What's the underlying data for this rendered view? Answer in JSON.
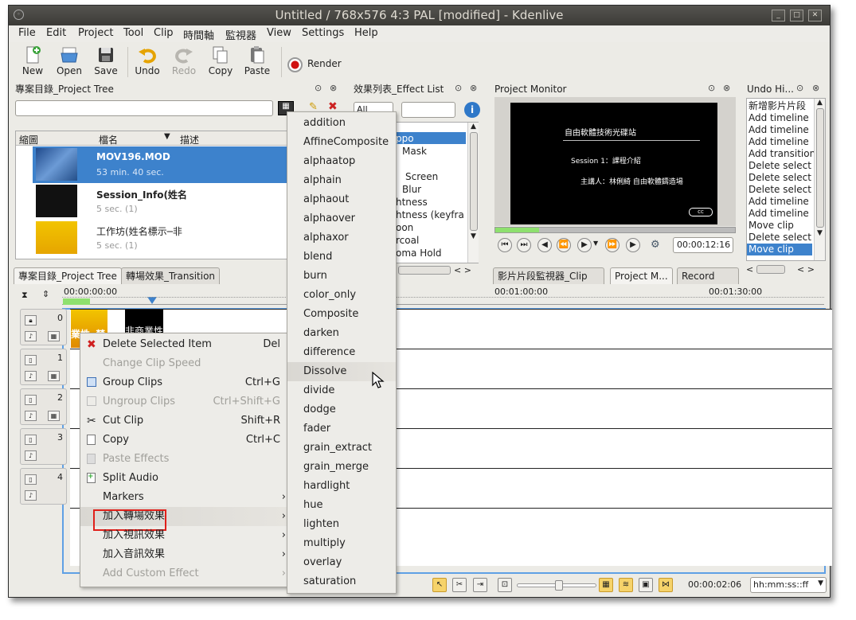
{
  "window": {
    "title": "Untitled / 768x576 4:3 PAL [modified]  -  Kdenlive"
  },
  "menubar": [
    "File",
    "Edit",
    "Project",
    "Tool",
    "Clip",
    "時間軸",
    "監視器",
    "View",
    "Settings",
    "Help"
  ],
  "toolbar": {
    "new": "New",
    "open": "Open",
    "save": "Save",
    "undo": "Undo",
    "redo": "Redo",
    "copy": "Copy",
    "paste": "Paste",
    "render": "Render"
  },
  "project_tree": {
    "title": "專案目錄_Project Tree",
    "columns": [
      "縮圖",
      "檔名",
      "描述"
    ],
    "items": [
      {
        "name": "MOV196.MOD",
        "info": "53 min. 40 sec."
      },
      {
        "name": "Session_Info(姓名",
        "info": "5 sec. (1)"
      },
      {
        "name": "工作坊(姓名標示─非",
        "info": "5 sec. (1)"
      }
    ],
    "tabs": [
      "專案目錄_Project Tree",
      "轉場效果_Transition"
    ]
  },
  "effect_list": {
    "title": "效果列表_Effect List",
    "filter": "All",
    "items": [
      "ppo",
      "Mask",
      "",
      "Screen",
      "Blur",
      "htness",
      "htness (keyfra",
      "oon",
      "rcoal",
      "oma Hold"
    ]
  },
  "monitor": {
    "title": "Project Monitor",
    "screen_line1": "自由軟體技術光碟站",
    "screen_line2": "Session 1：課程介紹",
    "screen_line3": "主講人：林俐綺 自由軟體鑄造場",
    "timecode": "00:00:12:16",
    "tabs": [
      "影片片段監視器_Clip M...",
      "Project M...",
      "Record M..."
    ]
  },
  "undo": {
    "title": "Undo Hi...",
    "items": [
      "新增影片片段",
      "Add timeline",
      "Add timeline",
      "Add timeline",
      "Add transition",
      "Delete select",
      "Delete select",
      "Delete select",
      "Add timeline",
      "Add timeline",
      "Move clip",
      "Delete select",
      "Move clip"
    ]
  },
  "timeline": {
    "ruler": [
      "00:00:00:00",
      "00:01:00:00",
      "00:01:30:00"
    ],
    "tracks": [
      "0",
      "1",
      "2",
      "3",
      "4"
    ],
    "clip_text1": "業性─禁",
    "clip_text2": "非商業性─",
    "timecode": "00:00:02:06",
    "format": "hh:mm:ss::ff"
  },
  "context_menu": {
    "items": [
      {
        "label": "Delete Selected Item",
        "shortcut": "Del",
        "enabled": true
      },
      {
        "label": "Change Clip Speed",
        "shortcut": "",
        "enabled": false
      },
      {
        "label": "Group Clips",
        "shortcut": "Ctrl+G",
        "enabled": true
      },
      {
        "label": "Ungroup Clips",
        "shortcut": "Ctrl+Shift+G",
        "enabled": false
      },
      {
        "label": "Cut Clip",
        "shortcut": "Shift+R",
        "enabled": true
      },
      {
        "label": "Copy",
        "shortcut": "Ctrl+C",
        "enabled": true
      },
      {
        "label": "Paste Effects",
        "shortcut": "",
        "enabled": false
      },
      {
        "label": "Split Audio",
        "shortcut": "",
        "enabled": true
      },
      {
        "label": "Markers",
        "shortcut": "",
        "enabled": true
      },
      {
        "label": "加入轉場效果",
        "shortcut": "",
        "enabled": true
      },
      {
        "label": "加入視訊效果",
        "shortcut": "",
        "enabled": true
      },
      {
        "label": "加入音訊效果",
        "shortcut": "",
        "enabled": true
      },
      {
        "label": "Add Custom Effect",
        "shortcut": "",
        "enabled": false
      }
    ]
  },
  "transition_submenu": [
    "addition",
    "AffineComposite",
    "alphaatop",
    "alphain",
    "alphaout",
    "alphaover",
    "alphaxor",
    "blend",
    "burn",
    "color_only",
    "Composite",
    "darken",
    "difference",
    "Dissolve",
    "divide",
    "dodge",
    "fader",
    "grain_extract",
    "grain_merge",
    "hardlight",
    "hue",
    "lighten",
    "multiply",
    "overlay",
    "saturation"
  ],
  "colors": {
    "selection": "#3d82cc",
    "highlight_box": "#e0201a",
    "title_bg": "#3c3b37"
  }
}
